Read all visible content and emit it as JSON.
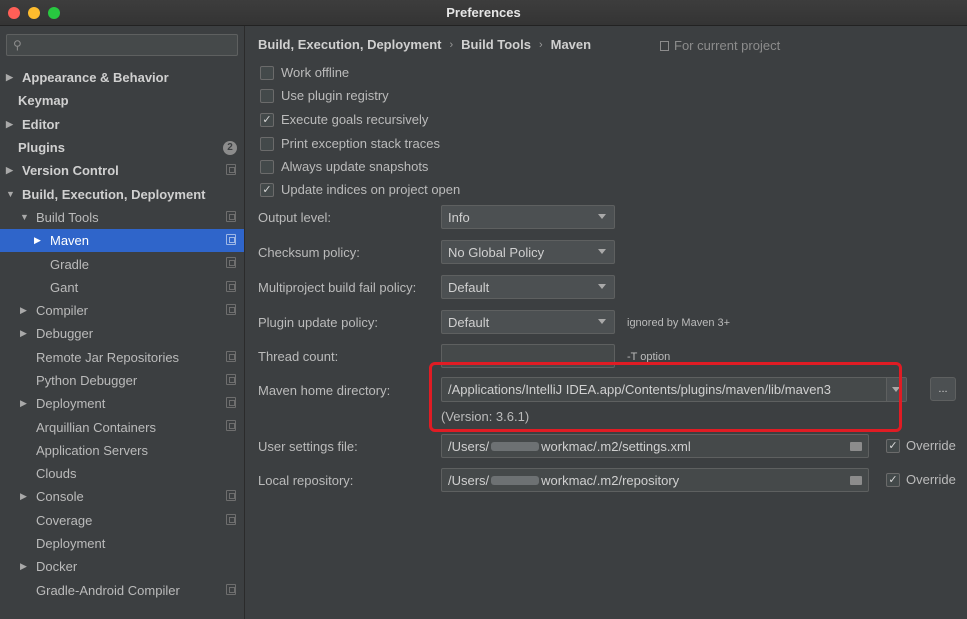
{
  "window": {
    "title": "Preferences"
  },
  "sidebar": {
    "search_placeholder": "",
    "items": [
      {
        "label": "Appearance & Behavior",
        "arrow": "▶",
        "bold": true,
        "indent": 0
      },
      {
        "label": "Keymap",
        "arrow": "",
        "bold": true,
        "indent": 0
      },
      {
        "label": "Editor",
        "arrow": "▶",
        "bold": true,
        "indent": 0
      },
      {
        "label": "Plugins",
        "arrow": "",
        "bold": true,
        "indent": 0,
        "badge": "2"
      },
      {
        "label": "Version Control",
        "arrow": "▶",
        "bold": true,
        "indent": 0,
        "proj": true
      },
      {
        "label": "Build, Execution, Deployment",
        "arrow": "▼",
        "bold": true,
        "indent": 0
      },
      {
        "label": "Build Tools",
        "arrow": "▼",
        "indent": 1,
        "proj": true
      },
      {
        "label": "Maven",
        "arrow": "▶",
        "indent": 2,
        "proj": true,
        "selected": true
      },
      {
        "label": "Gradle",
        "arrow": "",
        "indent": 2,
        "proj": true
      },
      {
        "label": "Gant",
        "arrow": "",
        "indent": 2,
        "proj": true
      },
      {
        "label": "Compiler",
        "arrow": "▶",
        "indent": 1,
        "proj": true
      },
      {
        "label": "Debugger",
        "arrow": "▶",
        "indent": 1
      },
      {
        "label": "Remote Jar Repositories",
        "arrow": "",
        "indent": 1,
        "proj": true
      },
      {
        "label": "Python Debugger",
        "arrow": "",
        "indent": 1,
        "proj": true
      },
      {
        "label": "Deployment",
        "arrow": "▶",
        "indent": 1,
        "proj": true
      },
      {
        "label": "Arquillian Containers",
        "arrow": "",
        "indent": 1,
        "proj": true
      },
      {
        "label": "Application Servers",
        "arrow": "",
        "indent": 1
      },
      {
        "label": "Clouds",
        "arrow": "",
        "indent": 1
      },
      {
        "label": "Console",
        "arrow": "▶",
        "indent": 1,
        "proj": true
      },
      {
        "label": "Coverage",
        "arrow": "",
        "indent": 1,
        "proj": true
      },
      {
        "label": "Deployment",
        "arrow": "",
        "indent": 1
      },
      {
        "label": "Docker",
        "arrow": "▶",
        "indent": 1
      },
      {
        "label": "Gradle-Android Compiler",
        "arrow": "",
        "indent": 1,
        "proj": true
      }
    ]
  },
  "breadcrumb": {
    "parts": [
      "Build, Execution, Deployment",
      "Build Tools",
      "Maven"
    ],
    "separator": "›",
    "for_project": "For current project"
  },
  "checkboxes": [
    {
      "label": "Work offline",
      "checked": false
    },
    {
      "label": "Use plugin registry",
      "checked": false
    },
    {
      "label": "Execute goals recursively",
      "checked": true
    },
    {
      "label": "Print exception stack traces",
      "checked": false
    },
    {
      "label": "Always update snapshots",
      "checked": false
    },
    {
      "label": "Update indices on project open",
      "checked": true
    }
  ],
  "form": {
    "output_level": {
      "label": "Output level:",
      "value": "Info"
    },
    "checksum_policy": {
      "label": "Checksum policy:",
      "value": "No Global Policy"
    },
    "multiproject_policy": {
      "label": "Multiproject build fail policy:",
      "value": "Default"
    },
    "plugin_update_policy": {
      "label": "Plugin update policy:",
      "value": "Default",
      "hint": "ignored by Maven 3+"
    },
    "thread_count": {
      "label": "Thread count:",
      "value": "",
      "hint": "-T option"
    },
    "maven_home": {
      "label": "Maven home directory:",
      "value": "/Applications/IntelliJ IDEA.app/Contents/plugins/maven/lib/maven3",
      "version": "(Version: 3.6.1)",
      "browse": "..."
    },
    "user_settings": {
      "label": "User settings file:",
      "prefix": "/Users/",
      "suffix": "workmac/.m2/settings.xml",
      "override": "Override"
    },
    "local_repo": {
      "label": "Local repository:",
      "prefix": "/Users/",
      "suffix": "workmac/.m2/repository",
      "override": "Override"
    }
  },
  "colors": {
    "accent": "#2f65ca",
    "highlight": "#e01c24",
    "background": "#3c3f41"
  }
}
